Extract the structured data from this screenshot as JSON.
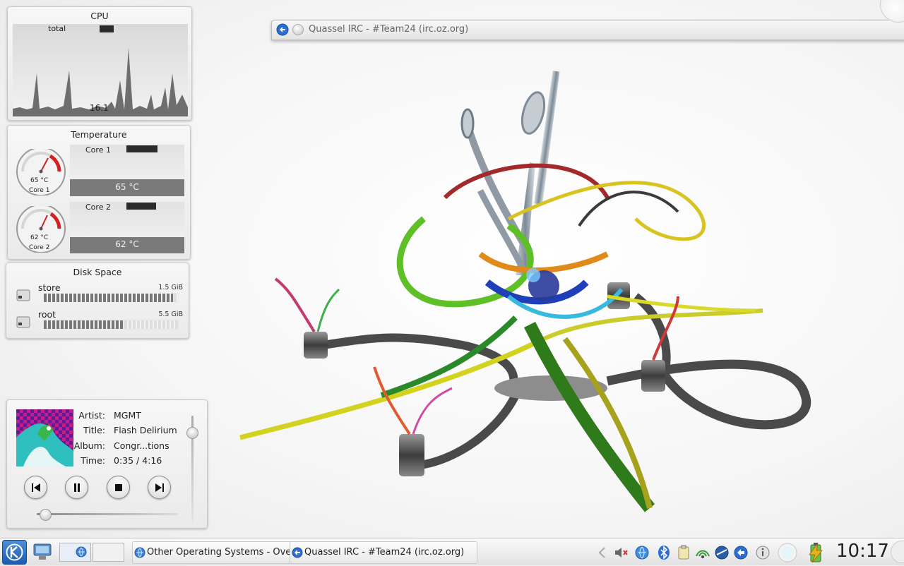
{
  "cpu": {
    "title": "CPU",
    "series_label": "total",
    "value": "16.1"
  },
  "temperature": {
    "title": "Temperature",
    "cores": [
      {
        "name": "Core 1",
        "value": "65 °C",
        "fraction": 0.65
      },
      {
        "name": "Core 2",
        "value": "62 °C",
        "fraction": 0.62
      }
    ]
  },
  "disk": {
    "title": "Disk Space",
    "items": [
      {
        "name": "store",
        "size": "1.5 GiB",
        "used_fraction": 0.97
      },
      {
        "name": "root",
        "size": "5.5 GiB",
        "used_fraction": 0.6
      }
    ]
  },
  "player": {
    "artist_label": "Artist:",
    "artist": "MGMT",
    "title_label": "Title:",
    "title": "Flash Delirium",
    "album_label": "Album:",
    "album": "Congr...tions",
    "time_label": "Time:",
    "time": "0:35 / 4:16",
    "progress_fraction": 0.14
  },
  "window": {
    "title": "Quassel IRC - #Team24 (irc.oz.org)"
  },
  "taskbar": {
    "tasks": [
      {
        "label": "Other Operating Systems - Overcloc"
      },
      {
        "label": "Quassel IRC - #Team24 (irc.oz.org)"
      }
    ]
  },
  "clock": {
    "time": "10:17"
  },
  "colors": {
    "accent": "#1b5bb3",
    "gauge_red": "#d42020",
    "graph_gray": "#6e6e6e"
  }
}
